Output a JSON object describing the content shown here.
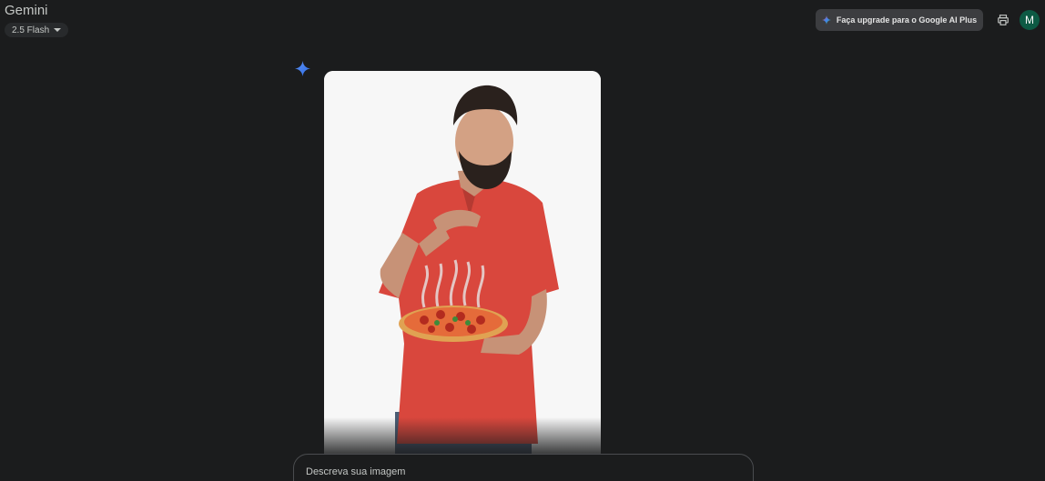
{
  "header": {
    "app_title": "Gemini",
    "model_label": "2.5 Flash",
    "upgrade_label": "Faça upgrade para o Google AI Plus",
    "avatar_letter": "M"
  },
  "icons": {
    "model_caret": "chevron-down-icon",
    "upgrade": "sparkle-icon",
    "print": "print-icon",
    "response": "gemini-spark-icon"
  },
  "response": {
    "image_subject": "Homem de camisa polo vermelha segurando uma pizza"
  },
  "prompt": {
    "placeholder": "Descreva sua imagem",
    "value": ""
  },
  "colors": {
    "background": "#1b1c1d",
    "upgrade_button": "#3c3d40",
    "avatar": "#0d5a44",
    "gemini_blue": "#4285f4",
    "shirt_red": "#d9473d"
  }
}
